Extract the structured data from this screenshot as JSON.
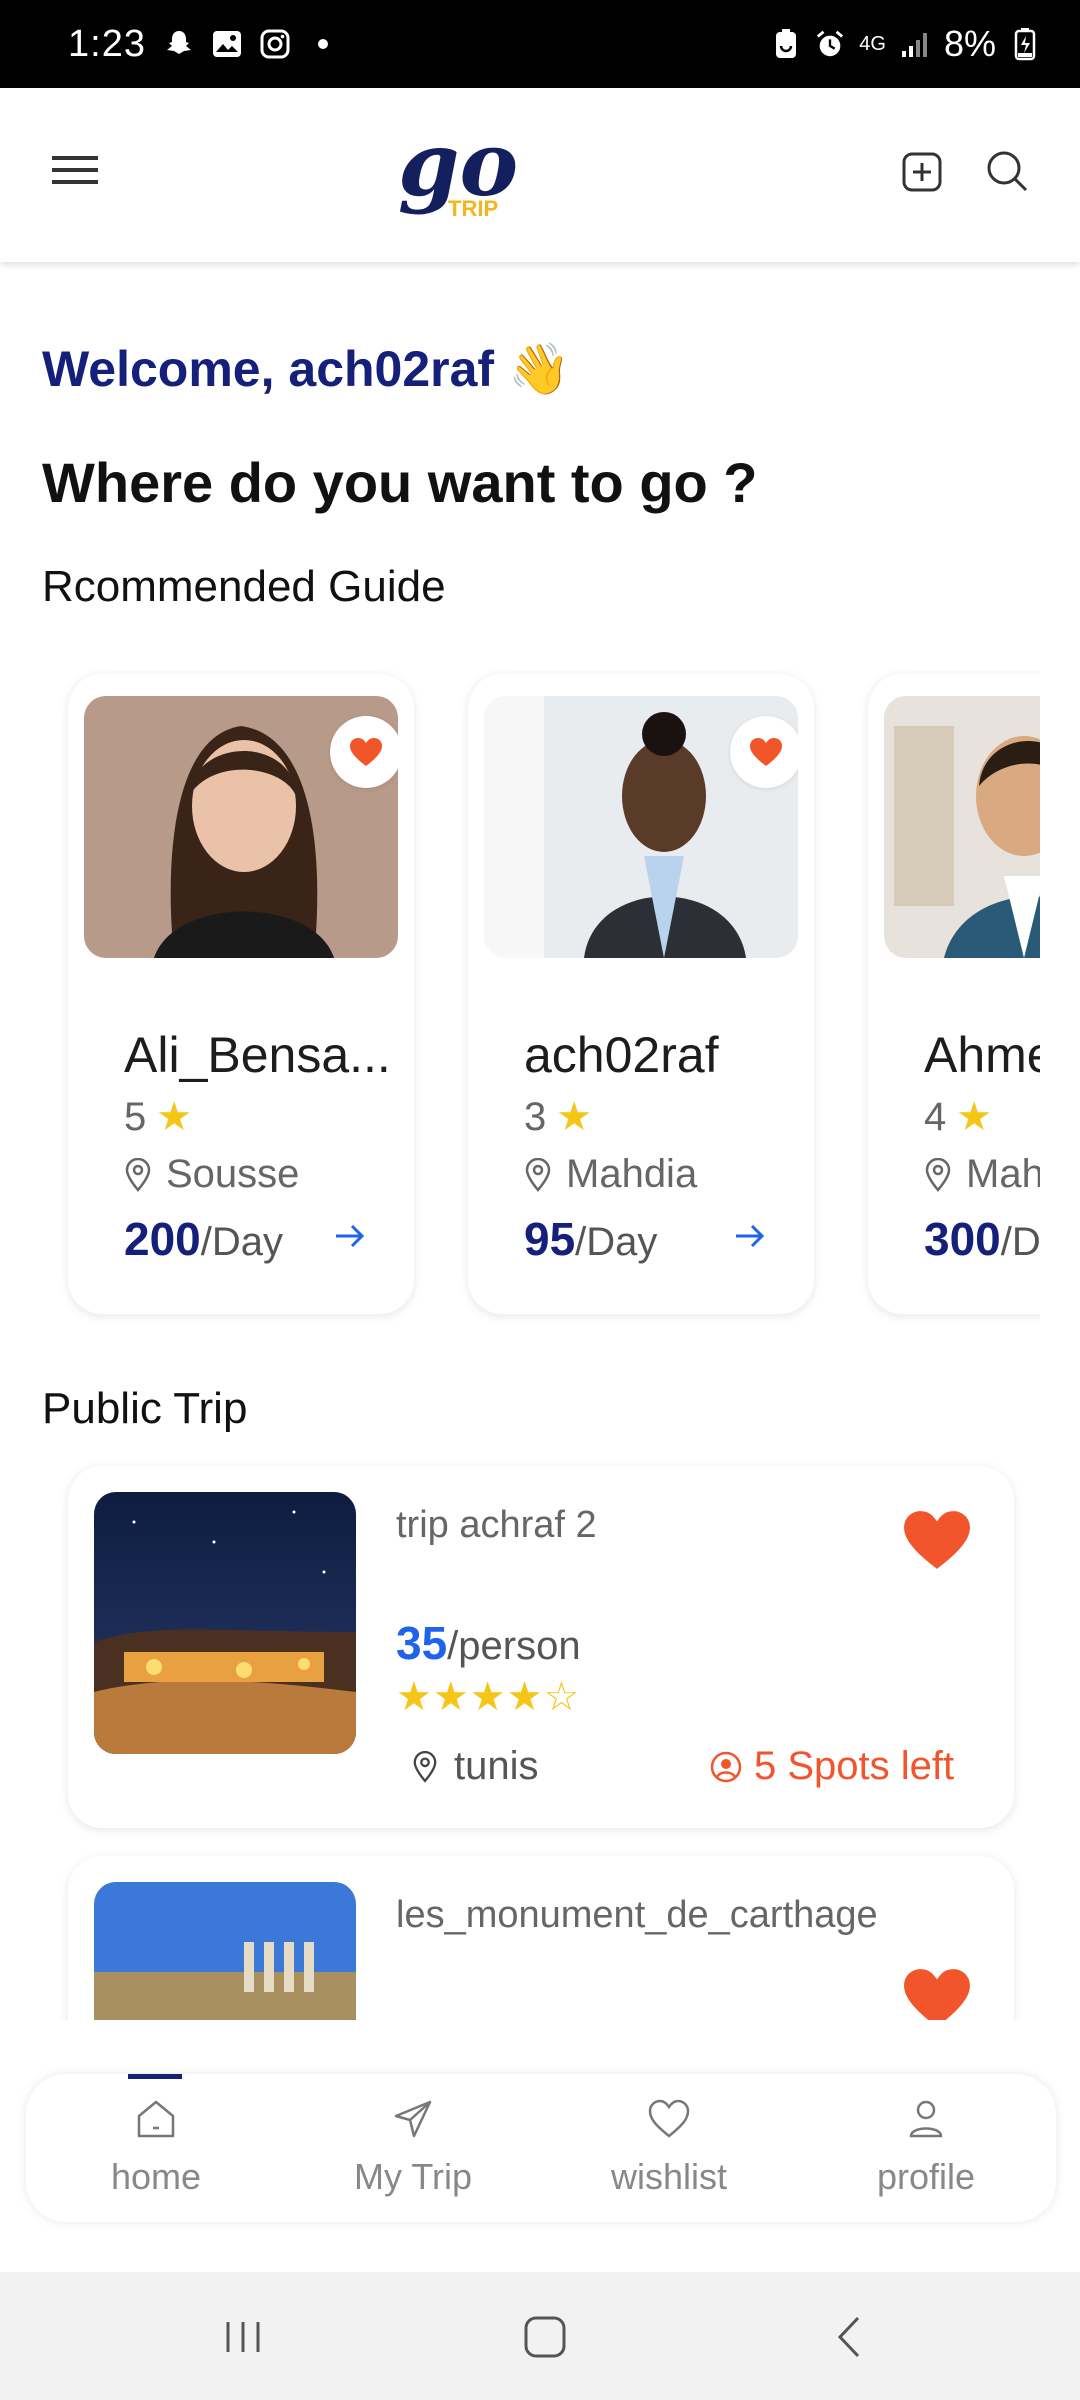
{
  "status_bar": {
    "time": "1:23",
    "network": "4G",
    "battery": "8%"
  },
  "header": {
    "logo_main": "go",
    "logo_sub": "TRIP"
  },
  "welcome": {
    "text": "Welcome, ach02raf",
    "emoji": "👋"
  },
  "headline": "Where do you want to go ?",
  "sections": {
    "guides_title": "Rcommended Guide",
    "trips_title": "Public Trip"
  },
  "guides": [
    {
      "name": "Ali_Bensa...",
      "rating": "5",
      "location": "Sousse",
      "price": "200",
      "unit": "/Day"
    },
    {
      "name": "ach02raf",
      "rating": "3",
      "location": "Mahdia",
      "price": "95",
      "unit": "/Day"
    },
    {
      "name": "Ahmed",
      "rating": "4",
      "location": "Mahdia",
      "price": "300",
      "unit": "/Day"
    }
  ],
  "trips": [
    {
      "title": "trip achraf 2",
      "price": "35",
      "unit": "/person",
      "stars": "★★★★☆",
      "location": "tunis",
      "spots": "5 Spots left"
    },
    {
      "title": "les_monument_de_carthage"
    }
  ],
  "bottom_nav": [
    {
      "label": "home",
      "icon": "home-icon",
      "active": true
    },
    {
      "label": "My Trip",
      "icon": "send-icon"
    },
    {
      "label": "wishlist",
      "icon": "heart-icon"
    },
    {
      "label": "profile",
      "icon": "user-icon"
    }
  ],
  "colors": {
    "brand_navy": "#14207a",
    "accent_orange": "#f2552c",
    "price_blue": "#1e63e9",
    "star_yellow": "#f5c518"
  }
}
